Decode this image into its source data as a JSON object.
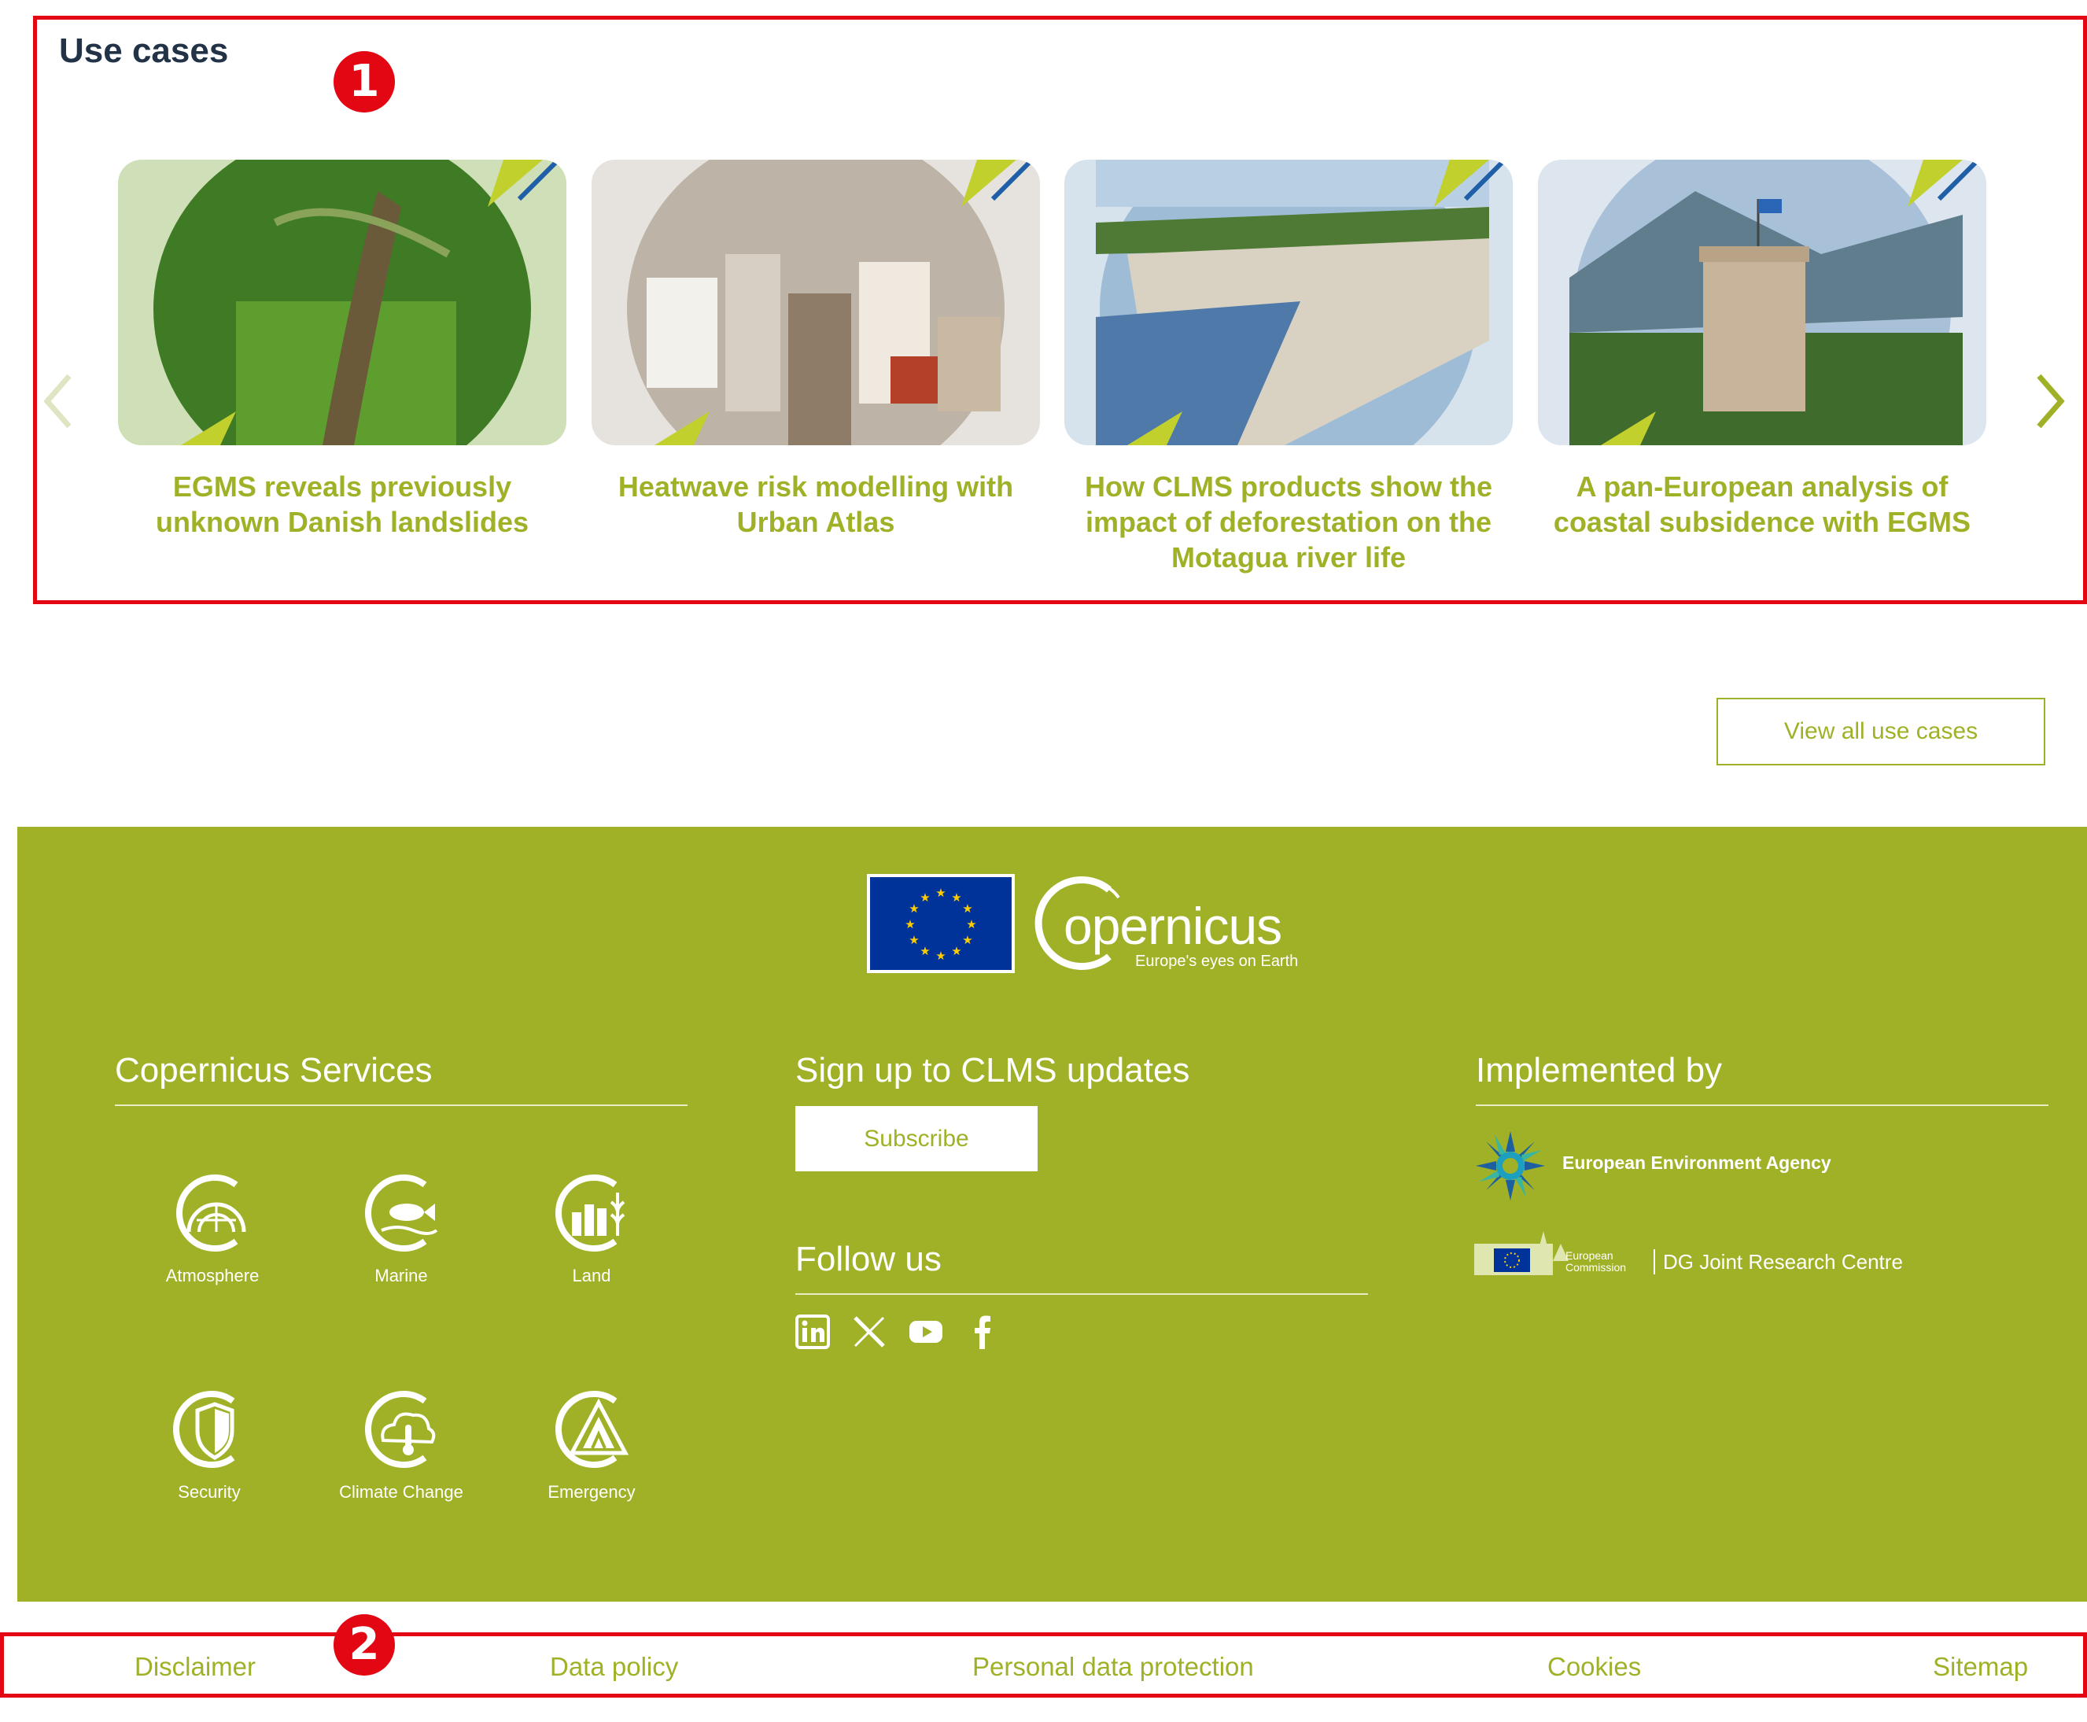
{
  "use_cases": {
    "title": "Use cases",
    "cards": [
      {
        "title": "EGMS reveals previously unknown Danish landslides"
      },
      {
        "title": "Heatwave risk modelling with Urban Atlas"
      },
      {
        "title": "How CLMS products show the impact of deforestation on the Motagua river life"
      },
      {
        "title": "A pan-European analysis of coastal subsidence with EGMS"
      }
    ],
    "view_all_label": "View all use cases"
  },
  "annotations": {
    "badge1": "1",
    "badge2": "2"
  },
  "footer": {
    "logo_text": "opernicus",
    "logo_initial": "C",
    "logo_tagline": "Europe's eyes on Earth",
    "services_title": "Copernicus Services",
    "services": [
      {
        "label": "Atmosphere",
        "icon": "atmosphere-icon"
      },
      {
        "label": "Marine",
        "icon": "marine-icon"
      },
      {
        "label": "Land",
        "icon": "land-icon"
      },
      {
        "label": "Security",
        "icon": "security-icon"
      },
      {
        "label": "Climate Change",
        "icon": "climate-change-icon"
      },
      {
        "label": "Emergency",
        "icon": "emergency-icon"
      }
    ],
    "signup_title": "Sign up to CLMS updates",
    "subscribe_label": "Subscribe",
    "follow_title": "Follow us",
    "social": [
      "linkedin-icon",
      "x-icon",
      "youtube-icon",
      "facebook-icon"
    ],
    "implemented_title": "Implemented by",
    "eea_label": "European Environment Agency",
    "ec_small": "European Commission",
    "jrc_label": "DG Joint Research Centre"
  },
  "bottom_links": [
    "Disclaimer",
    "Data policy",
    "Personal data protection",
    "Cookies",
    "Sitemap"
  ],
  "colors": {
    "accent": "#a0b128",
    "annotation_red": "#e30613",
    "title": "#223347"
  }
}
